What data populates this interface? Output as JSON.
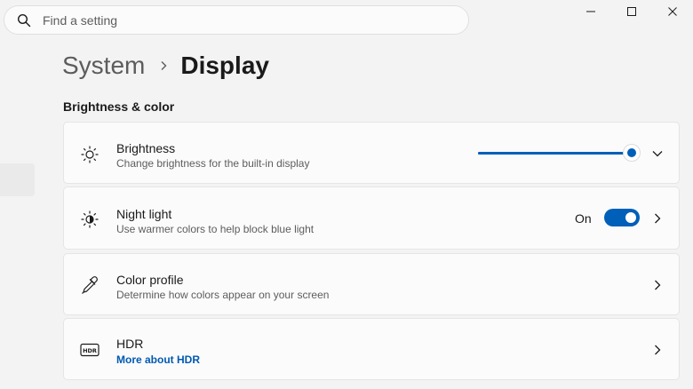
{
  "search": {
    "placeholder": "Find a setting"
  },
  "breadcrumb": {
    "parent": "System",
    "current": "Display"
  },
  "section": {
    "title": "Brightness & color"
  },
  "settings": [
    {
      "title": "Brightness",
      "description": "Change brightness for the built-in display",
      "icon": "sun-icon",
      "brightness_percent": 100
    },
    {
      "title": "Night light",
      "description": "Use warmer colors to help block blue light",
      "icon": "half-sun-icon",
      "state_label": "On",
      "toggle_on": true
    },
    {
      "title": "Color profile",
      "description": "Determine how colors appear on your screen",
      "icon": "eyedropper-icon"
    },
    {
      "title": "HDR",
      "description": "More about HDR",
      "icon": "hdr-icon"
    }
  ],
  "colors": {
    "accent": "#005fb8",
    "link": "#0059b3",
    "background": "#f3f3f3",
    "card": "#fbfbfb"
  }
}
